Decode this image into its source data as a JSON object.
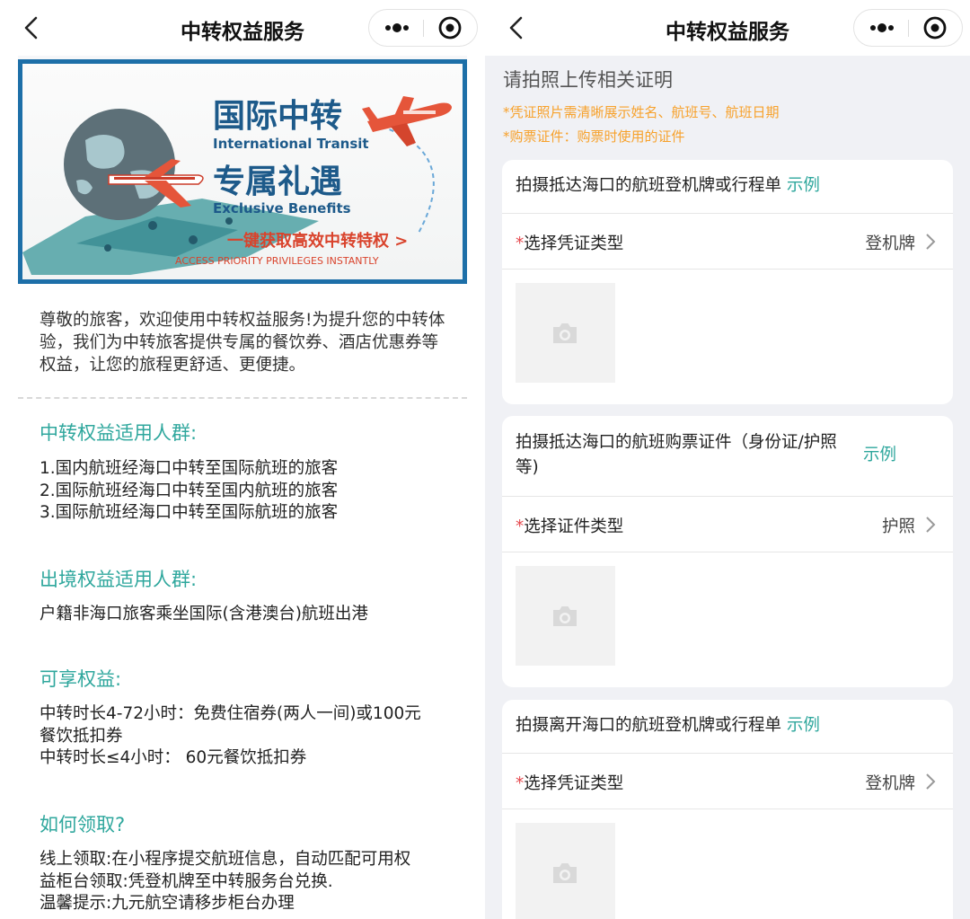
{
  "left": {
    "nav": {
      "title": "中转权益服务"
    },
    "banner": {
      "title_cn": "国际中转",
      "title_en": "International Transit",
      "subtitle_cn": "专属礼遇",
      "subtitle_en": "Exclusive Benefits",
      "cta_cn": "一键获取高效中转特权 >",
      "cta_en": "ACCESS PRIORITY PRIVILEGES INSTANTLY"
    },
    "intro": "尊敬的旅客，欢迎使用中转权益服务!为提升您的中转体验，我们为中转旅客提供专属的餐饮券、酒店优惠券等权益，让您的旅程更舒适、更便捷。",
    "sections": [
      {
        "title": "中转权益适用人群:",
        "lines": [
          "1.国内航班经海口中转至国际航班的旅客",
          "2.国际航班经海口中转至国内航班的旅客",
          "3.国际航班经海口中转至国际航班的旅客"
        ]
      },
      {
        "title": "出境权益适用人群:",
        "lines": [
          "户籍非海口旅客乘坐国际(含港澳台)航班出港"
        ]
      },
      {
        "title": "可享权益:",
        "lines": [
          "中转时长4-72小时：免费住宿券(两人一间)或100元",
          "餐饮抵扣券",
          "中转时长≤4小时： 60元餐饮抵扣券"
        ]
      },
      {
        "title": "如何领取?",
        "lines": [
          "线上领取:在小程序提交航班信息，自动匹配可用权",
          "益柜台领取:凭登机牌至中转服务台兑换.",
          "温馨提示:九元航空请移步柜台办理"
        ]
      }
    ]
  },
  "right": {
    "nav": {
      "title": "中转权益服务"
    },
    "upload_title": "请拍照上传相关证明",
    "notes": [
      "*凭证照片需清晰展示姓名、航班号、航班日期",
      "*购票证件：购票时使用的证件"
    ],
    "cards": [
      {
        "title": "拍摄抵达海口的航班登机牌或行程单",
        "title_line2": "",
        "example": "示例",
        "select_label": "选择凭证类型",
        "select_value": "登机牌"
      },
      {
        "title": "拍摄抵达海口的航班购票证件（身份证/护照",
        "title_line2": "等)",
        "example": "示例",
        "select_label": "选择证件类型",
        "select_value": "护照"
      },
      {
        "title": "拍摄离开海口的航班登机牌或行程单",
        "title_line2": "",
        "example": "示例",
        "select_label": "选择凭证类型",
        "select_value": "登机牌"
      }
    ]
  },
  "colors": {
    "accent": "#2fa79d",
    "note": "#f7a12b",
    "required": "#e5484d",
    "banner_border": "#1d6fa8"
  },
  "icons": [
    "back-arrow-icon",
    "more-dots-icon",
    "close-target-icon",
    "chevron-right-icon",
    "camera-icon",
    "airplane-icon",
    "globe-icon"
  ]
}
